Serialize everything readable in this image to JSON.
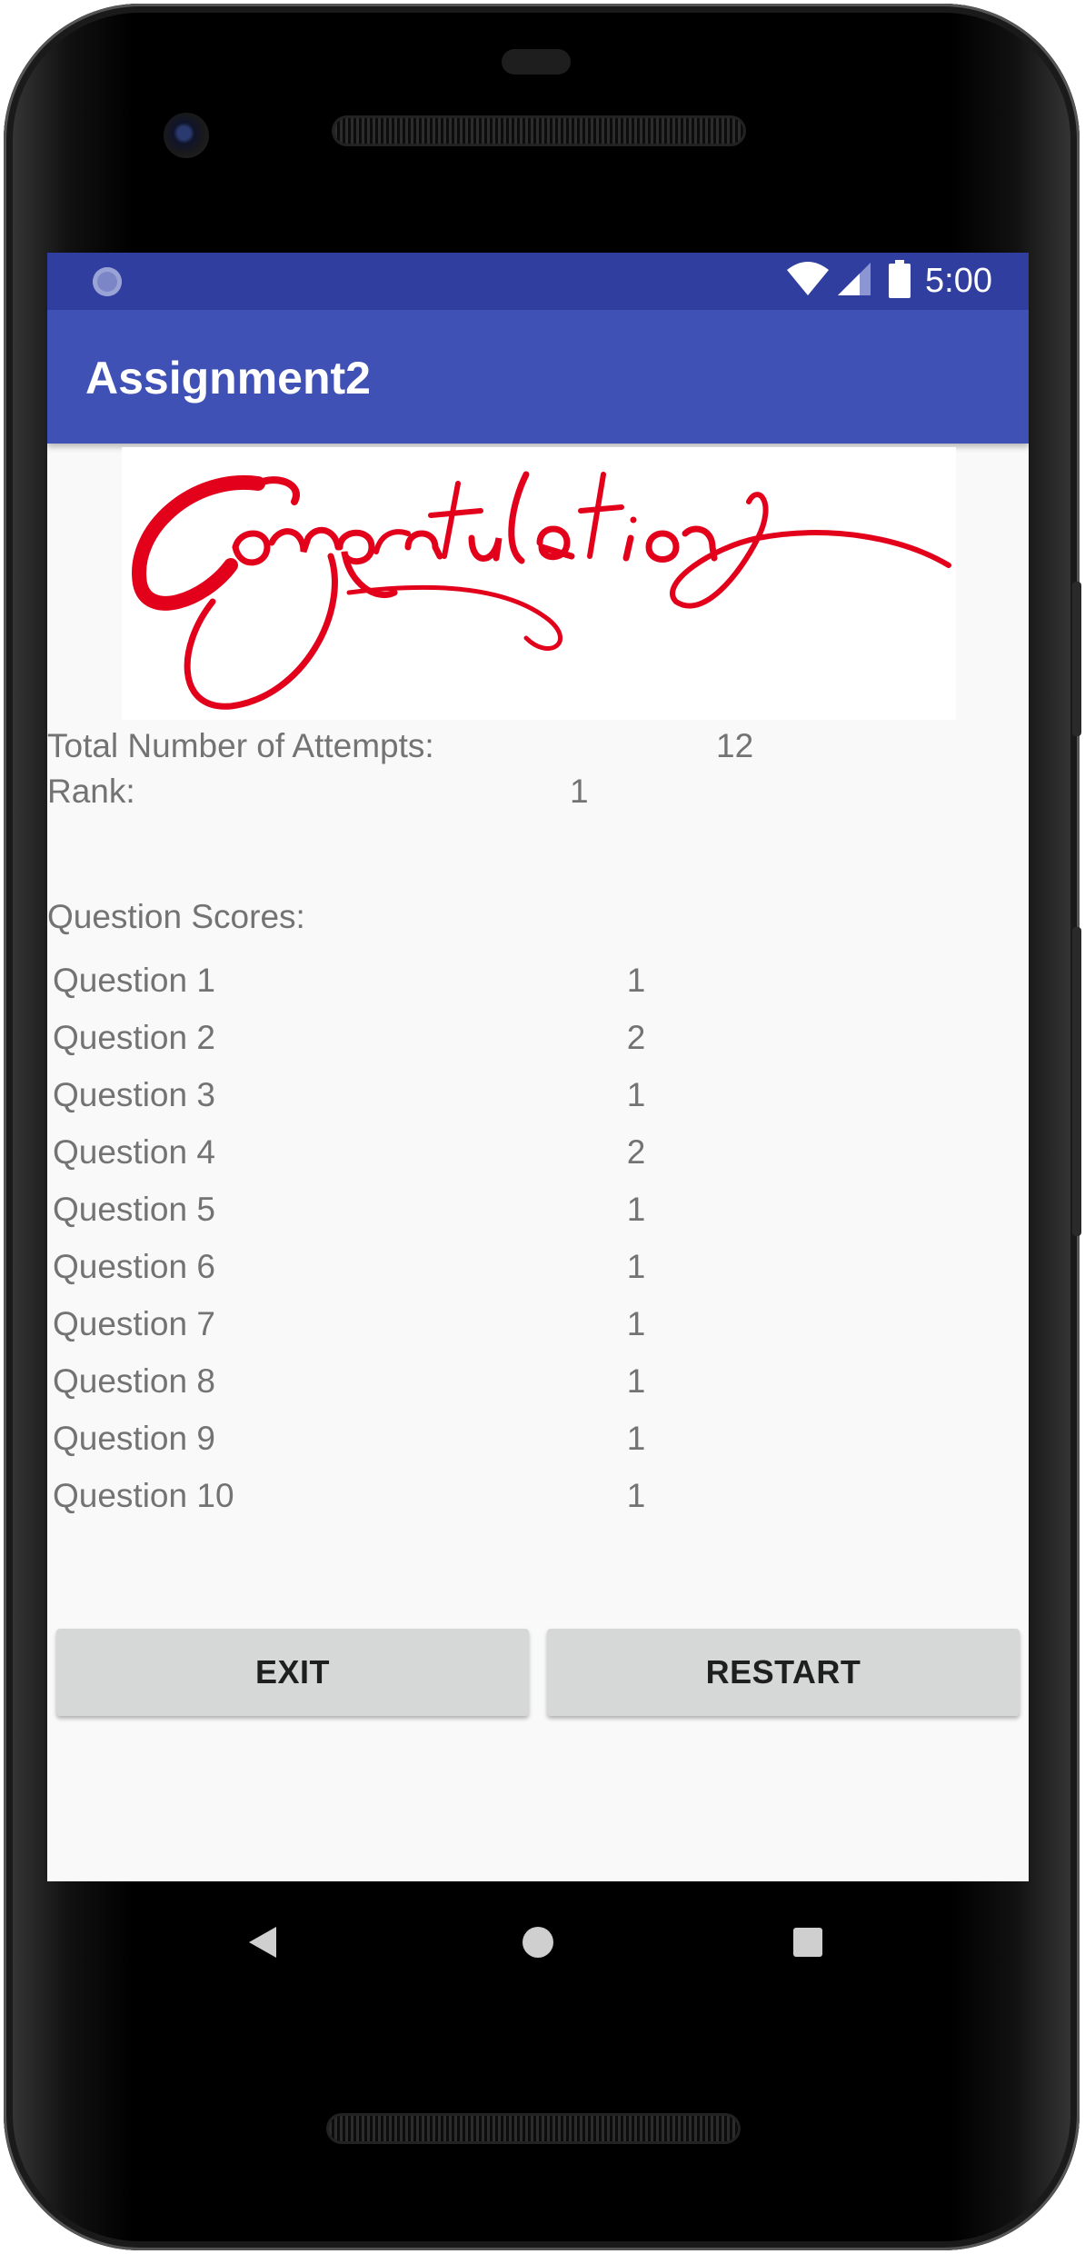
{
  "status_bar": {
    "time": "5:00",
    "icons": [
      "notification-dot-icon",
      "wifi-icon",
      "cellular-signal-icon",
      "battery-icon"
    ],
    "color": "#303f9f"
  },
  "app_bar": {
    "title": "Assignment2",
    "color": "#3f51b5"
  },
  "banner": {
    "text": "Congratulations",
    "color": "#e3001b"
  },
  "summary": {
    "attempts_label": "Total Number of Attempts:",
    "attempts_value": "12",
    "rank_label": "Rank:",
    "rank_value": "1"
  },
  "scores": {
    "header": "Question Scores:",
    "rows": [
      {
        "label": "Question 1",
        "value": "1"
      },
      {
        "label": "Question 2",
        "value": "2"
      },
      {
        "label": "Question 3",
        "value": "1"
      },
      {
        "label": "Question 4",
        "value": "2"
      },
      {
        "label": "Question 5",
        "value": "1"
      },
      {
        "label": "Question 6",
        "value": "1"
      },
      {
        "label": "Question 7",
        "value": "1"
      },
      {
        "label": "Question 8",
        "value": "1"
      },
      {
        "label": "Question 9",
        "value": "1"
      },
      {
        "label": "Question 10",
        "value": "1"
      }
    ]
  },
  "buttons": {
    "exit": "EXIT",
    "restart": "RESTART"
  },
  "nav_bar": {
    "icons": [
      "back-icon",
      "home-icon",
      "recents-icon"
    ]
  }
}
